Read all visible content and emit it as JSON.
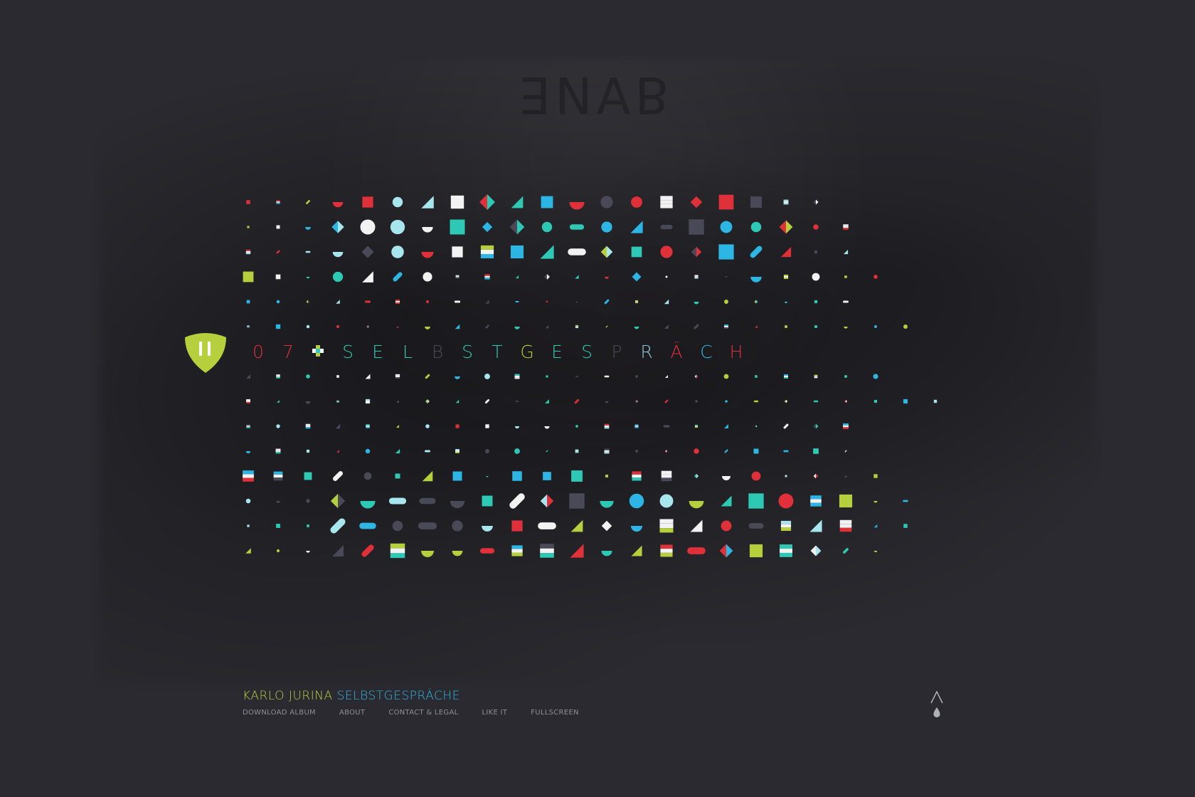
{
  "track": {
    "number_chars": [
      "0",
      "7"
    ],
    "name_chars": [
      "S",
      "E",
      "L",
      "B",
      "S",
      "T",
      "G",
      "E",
      "S",
      "P",
      "R",
      "Ä",
      "C",
      "H"
    ],
    "number_color": "#e0303a",
    "name_colors": [
      "#2ec9b4",
      "#2ec9b4",
      "#2ec9b4",
      "#4a4958",
      "#2ec9b4",
      "#2ec9b4",
      "#b5cf3d",
      "#2ec9b4",
      "#2ec9b4",
      "#4a4958",
      "#8fc8d8",
      "#e0303a",
      "#2db6e3",
      "#e0303a"
    ],
    "plus_icon": "plus-icon"
  },
  "player": {
    "state": "playing",
    "icon": "pause-icon",
    "color": "#b5cf3d"
  },
  "footer": {
    "artist": "KARLO JURINA",
    "album": "SELBSTGESPRÄCHE",
    "nav": {
      "download": "DOWNLOAD ALBUM",
      "about": "ABOUT",
      "contact": "CONTACT & LEGAL",
      "like": "LIKE IT",
      "fullscreen": "FULLSCREEN"
    }
  },
  "palette": {
    "red": "#e0303a",
    "cyan": "#2db6e3",
    "teal": "#2ec9b4",
    "lime": "#b5cf3d",
    "white": "#f2f2f2",
    "dark": "#4a4958",
    "pale": "#a8e6ee",
    "yellow": "#f0d040",
    "orange": "#e88a30"
  },
  "logo": {
    "icon": "arrow-drop-logo-icon",
    "color": "#b0b0b8"
  }
}
